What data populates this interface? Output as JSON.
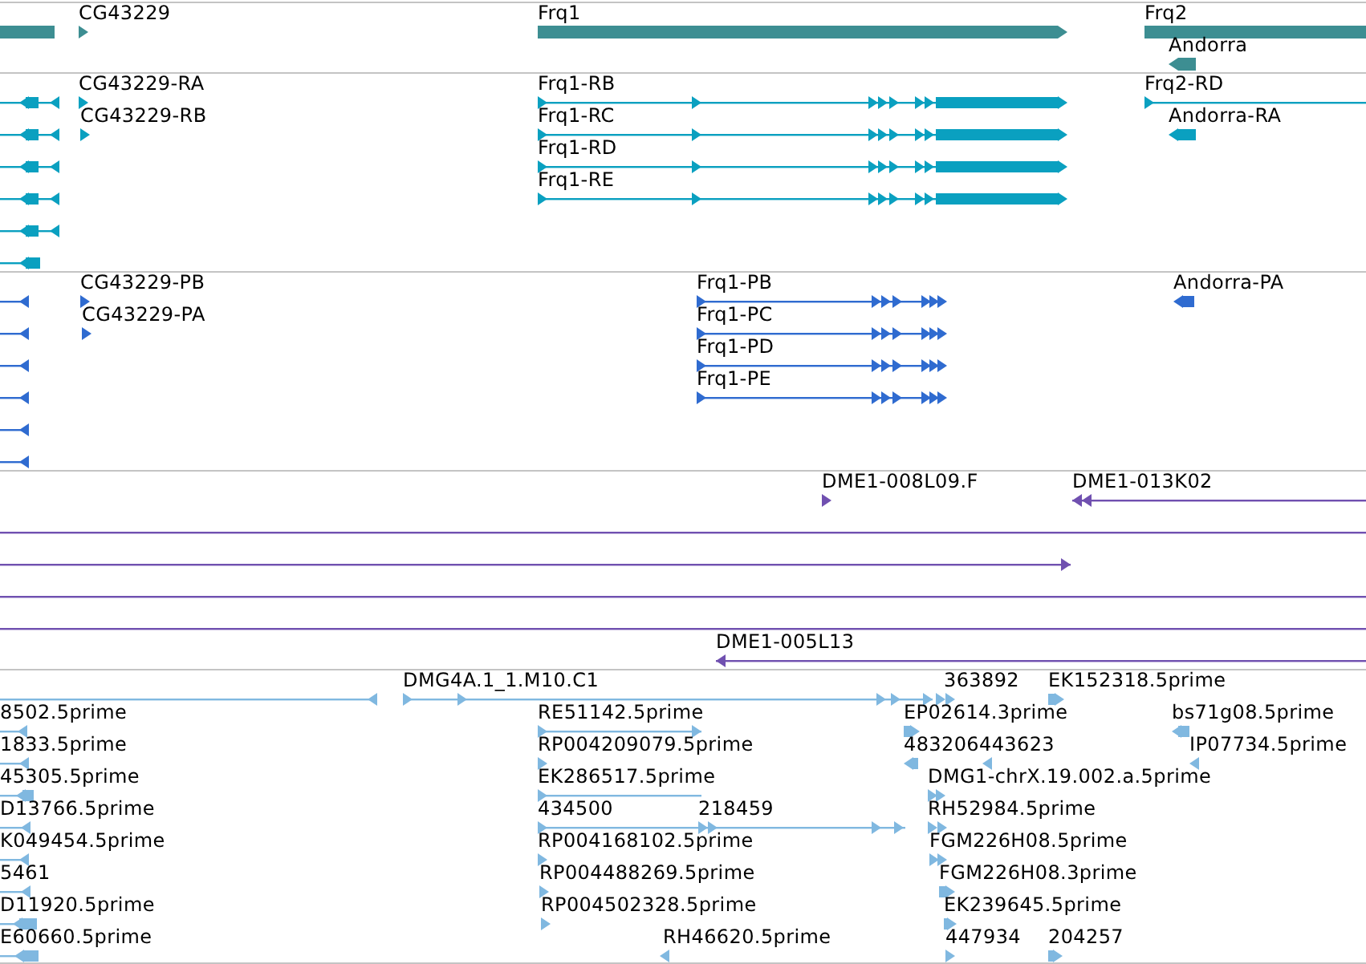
{
  "tracks": [
    {
      "kind": "gene",
      "features": [
        {
          "kind": "stub"
        },
        {
          "label": "CG43229",
          "reverse": false
        },
        {
          "label": "Frq1",
          "reverse": false
        },
        {
          "label": "Frq2"
        },
        {
          "label": "Andorra",
          "reverse": true
        }
      ]
    },
    {
      "kind": "transcript",
      "features": [
        {
          "reverse": true
        },
        {
          "reverse": true
        },
        {
          "reverse": true
        },
        {
          "reverse": true
        },
        {
          "reverse": true
        },
        {
          "reverse": true
        },
        {
          "label": "CG43229-RA",
          "reverse": false
        },
        {
          "label": "CG43229-RB",
          "reverse": false
        },
        {
          "label": "Frq1-RB",
          "reverse": false
        },
        {
          "label": "Frq1-RC",
          "reverse": false
        },
        {
          "label": "Frq1-RD",
          "reverse": false
        },
        {
          "label": "Frq1-RE",
          "reverse": false
        },
        {
          "label": "Frq2-RD",
          "reverse": false
        },
        {
          "label": "Andorra-RA",
          "reverse": true
        }
      ]
    },
    {
      "kind": "protein",
      "features": [
        {
          "reverse": true
        },
        {
          "reverse": true
        },
        {
          "reverse": true
        },
        {
          "reverse": true
        },
        {
          "reverse": true
        },
        {
          "reverse": true
        },
        {
          "label": "CG43229-PB",
          "reverse": false
        },
        {
          "label": "CG43229-PA",
          "reverse": false
        },
        {
          "label": "Frq1-PB",
          "reverse": false
        },
        {
          "label": "Frq1-PC",
          "reverse": false
        },
        {
          "label": "Frq1-PD",
          "reverse": false
        },
        {
          "label": "Frq1-PE",
          "reverse": false
        },
        {
          "label": "Andorra-PA",
          "reverse": true
        }
      ]
    },
    {
      "kind": "clone",
      "features": [
        {
          "kind": "clone",
          "label": "DME1-008L09.F",
          "reverse": false
        },
        {
          "kind": "clone",
          "label": "DME1-013K02",
          "reverse": true
        },
        {
          "kind": "span"
        },
        {
          "kind": "clone",
          "reverse": false
        },
        {
          "kind": "span"
        },
        {
          "kind": "span"
        },
        {
          "kind": "clone",
          "label": "DME1-005L13",
          "reverse": true
        }
      ]
    },
    {
      "kind": "est",
      "features": [
        {
          "reverse": true
        },
        {
          "label": "DMG4A.1_1.M10.C1",
          "reverse": false
        },
        {
          "label": "363892",
          "reverse": false
        },
        {
          "label": "EK152318.5prime",
          "reverse": false
        },
        {
          "label": "8502.5prime",
          "reverse": true
        },
        {
          "label": "RE51142.5prime",
          "reverse": false
        },
        {
          "label": "EP02614.3prime",
          "reverse": false
        },
        {
          "label": "bs71g08.5prime",
          "reverse": true
        },
        {
          "label": "1833.5prime",
          "reverse": true
        },
        {
          "label": "RP004209079.5prime",
          "reverse": false
        },
        {
          "label": "483206443623",
          "reverse": true
        },
        {
          "label": "IP07734.5prime",
          "reverse": true
        },
        {
          "label": "45305.5prime",
          "reverse": true
        },
        {
          "label": "EK286517.5prime",
          "reverse": false
        },
        {
          "label": "DMG1-chrX.19.002.a.5prime",
          "reverse": false
        },
        {
          "label": "D13766.5prime",
          "reverse": true
        },
        {
          "label": "434500",
          "reverse": false
        },
        {
          "label": "218459",
          "reverse": false
        },
        {
          "label": "RH52984.5prime",
          "reverse": false
        },
        {
          "label": "K049454.5prime",
          "reverse": true
        },
        {
          "label": "RP004168102.5prime",
          "reverse": false
        },
        {
          "label": "FGM226H08.5prime",
          "reverse": false
        },
        {
          "label": "5461",
          "reverse": true
        },
        {
          "label": "RP004488269.5prime",
          "reverse": false
        },
        {
          "label": "FGM226H08.3prime",
          "reverse": false
        },
        {
          "label": "D11920.5prime",
          "reverse": true
        },
        {
          "label": "RP004502328.5prime",
          "reverse": false
        },
        {
          "label": "EK239645.5prime",
          "reverse": false
        },
        {
          "label": "E60660.5prime",
          "reverse": true
        },
        {
          "label": "RH46620.5prime",
          "reverse": true
        },
        {
          "label": "447934",
          "reverse": false
        },
        {
          "label": "204257",
          "reverse": false
        }
      ]
    }
  ]
}
